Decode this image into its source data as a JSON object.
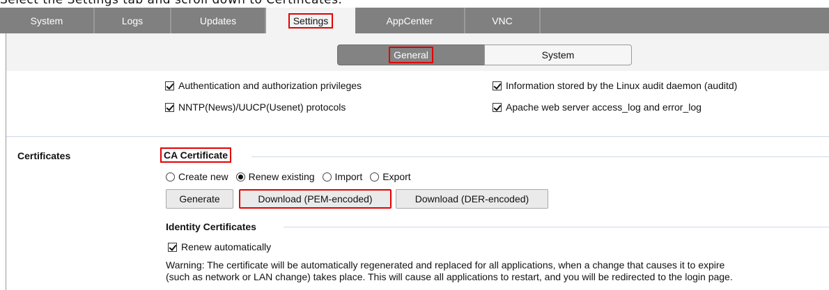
{
  "caption": "Select the Settings tab and scroll down to Certificates.",
  "tabs": [
    {
      "label": "System"
    },
    {
      "label": "Logs"
    },
    {
      "label": "Updates"
    },
    {
      "label": "Settings"
    },
    {
      "label": "AppCenter"
    },
    {
      "label": "VNC"
    }
  ],
  "subtabs": {
    "general": "General",
    "system": "System"
  },
  "log_options": {
    "auth": "Authentication and authorization privileges",
    "nntp": "NNTP(News)/UUCP(Usenet) protocols",
    "auditd": "Information stored by the Linux audit daemon (auditd)",
    "apache": "Apache web server access_log and error_log"
  },
  "certificates": {
    "section_label": "Certificates",
    "ca_title": "CA Certificate",
    "radio": {
      "create_new": "Create new",
      "renew_existing": "Renew existing",
      "import": "Import",
      "export": "Export",
      "selected": "Renew existing"
    },
    "buttons": {
      "generate": "Generate",
      "download_pem": "Download (PEM-encoded)",
      "download_der": "Download (DER-encoded)"
    },
    "identity_title": "Identity Certificates",
    "renew_auto": "Renew automatically",
    "warning_line1": "Warning: The certificate will be automatically regenerated and replaced for all applications, when a change that causes it to expire",
    "warning_line2": "(such as network or LAN change) takes place. This will cause all applications to restart, and you will be redirected to the login page."
  },
  "colors": {
    "highlight": "#e10000",
    "tabbar": "#808080",
    "active_tab": "#f3f3f3"
  }
}
